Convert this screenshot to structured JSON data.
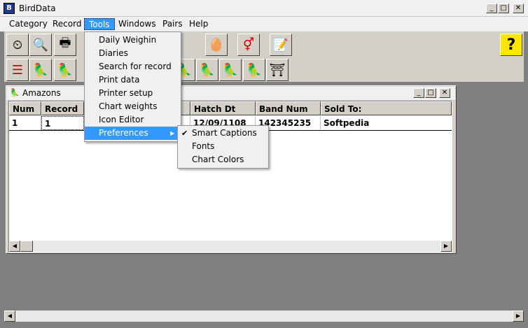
{
  "window": {
    "title": "BirdData",
    "min": "_",
    "max": "□",
    "close": "✕"
  },
  "menubar": [
    "Category",
    "Record",
    "Tools",
    "Windows",
    "Pairs",
    "Help"
  ],
  "toolbar1": [
    {
      "icon": "scale-icon",
      "glyph": "⏲"
    },
    {
      "icon": "magnifier-icon",
      "glyph": "🔍"
    },
    {
      "icon": "printer-icon",
      "glyph": "🖶"
    },
    {
      "icon": "egg-chick-icon",
      "glyph": "🥚"
    },
    {
      "icon": "gender-pair-icon",
      "glyph": "⚥"
    },
    {
      "icon": "document-pen-icon",
      "glyph": "📝"
    },
    {
      "icon": "help-icon",
      "glyph": "?"
    }
  ],
  "toolbar2": [
    {
      "icon": "list-icon",
      "glyph": "☰"
    },
    {
      "icon": "grey-parrot-icon",
      "glyph": "🦜"
    },
    {
      "icon": "macaw-icon",
      "glyph": "🦜"
    },
    {
      "icon": "green-parrot-icon",
      "glyph": "🦜"
    },
    {
      "icon": "lovebird-icon",
      "glyph": "🦜"
    },
    {
      "icon": "amazon-icon",
      "glyph": "🦜"
    },
    {
      "icon": "red-parrot-icon",
      "glyph": "🦜"
    },
    {
      "icon": "birdcage-icon",
      "glyph": "⛩"
    }
  ],
  "child": {
    "title": "Amazons",
    "columns": [
      "Num",
      "Record",
      "",
      "Hatch Dt",
      "Band Num",
      "Sold To:"
    ],
    "row": [
      "1",
      "1",
      "",
      "12/09/1108",
      "142345235",
      "Softpedia"
    ]
  },
  "tools_menu": [
    "Daily Weighin",
    "Diaries",
    "Search for record",
    "Print data",
    "Printer setup",
    "Chart weights",
    "Icon Editor",
    "Preferences"
  ],
  "preferences_menu": [
    {
      "label": "Smart Captions",
      "checked": "✔"
    },
    {
      "label": "Fonts",
      "checked": ""
    },
    {
      "label": "Chart Colors",
      "checked": ""
    }
  ],
  "colors": {
    "menu_highlight": "#3399ff",
    "face": "#d4d0c8",
    "mdi_bg": "#808080"
  }
}
